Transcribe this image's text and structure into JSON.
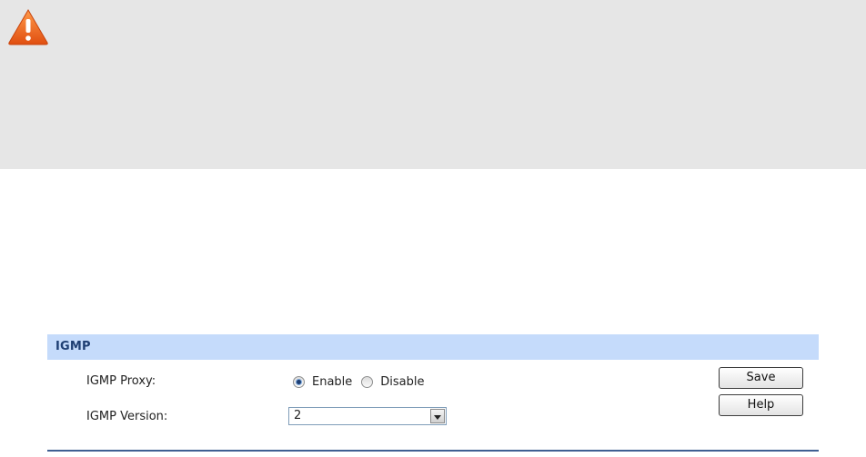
{
  "panel": {
    "title": "IGMP"
  },
  "igmp_proxy": {
    "label": "IGMP Proxy:",
    "options": [
      "Enable",
      "Disable"
    ],
    "selected": "Enable"
  },
  "igmp_version": {
    "label": "IGMP Version:",
    "value": "2"
  },
  "buttons": {
    "save": "Save",
    "help": "Help"
  },
  "icons": {
    "warning": "warning-icon",
    "dropdown": "chevron-down-icon"
  },
  "colors": {
    "banner_bg": "#e6e6e6",
    "header_bg": "#c5dbfb",
    "warning": "#f26b21"
  }
}
